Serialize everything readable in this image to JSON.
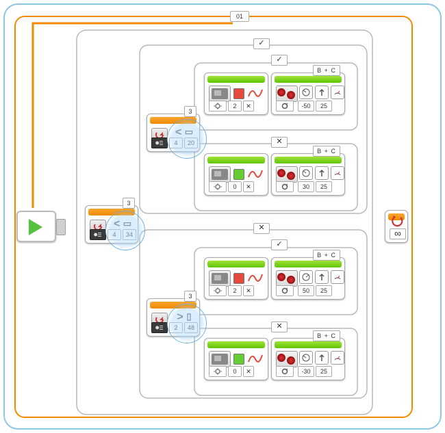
{
  "loop": {
    "name": "01",
    "end_mode": "infinite",
    "infinity": "∞"
  },
  "outer_switch": {
    "sensor": "color-sensor",
    "mode": "compare-ambient",
    "operator": "<",
    "threshold_index": "4",
    "threshold": "34",
    "port": "3"
  },
  "tabs": {
    "outer_true": "✓",
    "outer_false": "✕",
    "upper_true": "✓",
    "upper_false": "✕",
    "lower_true": "✓",
    "lower_false": "✕"
  },
  "upper_switch": {
    "sensor": "color-sensor",
    "mode": "compare-ambient",
    "operator": "<",
    "threshold_index": "4",
    "threshold": "20",
    "port": "3",
    "true_case": {
      "led": {
        "color": "red",
        "color_index": "2",
        "pulse": "✕"
      },
      "move": {
        "ports": "B + C",
        "steering": "-50",
        "power": "25",
        "mode": "on"
      }
    },
    "false_case": {
      "led": {
        "color": "green",
        "color_index": "0",
        "pulse": "✕"
      },
      "move": {
        "ports": "B + C",
        "steering": "30",
        "power": "25",
        "mode": "on"
      }
    }
  },
  "lower_switch": {
    "sensor": "color-sensor",
    "mode": "compare-ambient",
    "operator": ">",
    "threshold_index": "2",
    "threshold": "48",
    "port": "3",
    "true_case": {
      "led": {
        "color": "red",
        "color_index": "2",
        "pulse": "✕"
      },
      "move": {
        "ports": "B + C",
        "steering": "50",
        "power": "25",
        "mode": "on"
      }
    },
    "false_case": {
      "led": {
        "color": "green",
        "color_index": "0",
        "pulse": "✕"
      },
      "move": {
        "ports": "B + C",
        "steering": "-30",
        "power": "25",
        "mode": "on"
      }
    }
  }
}
